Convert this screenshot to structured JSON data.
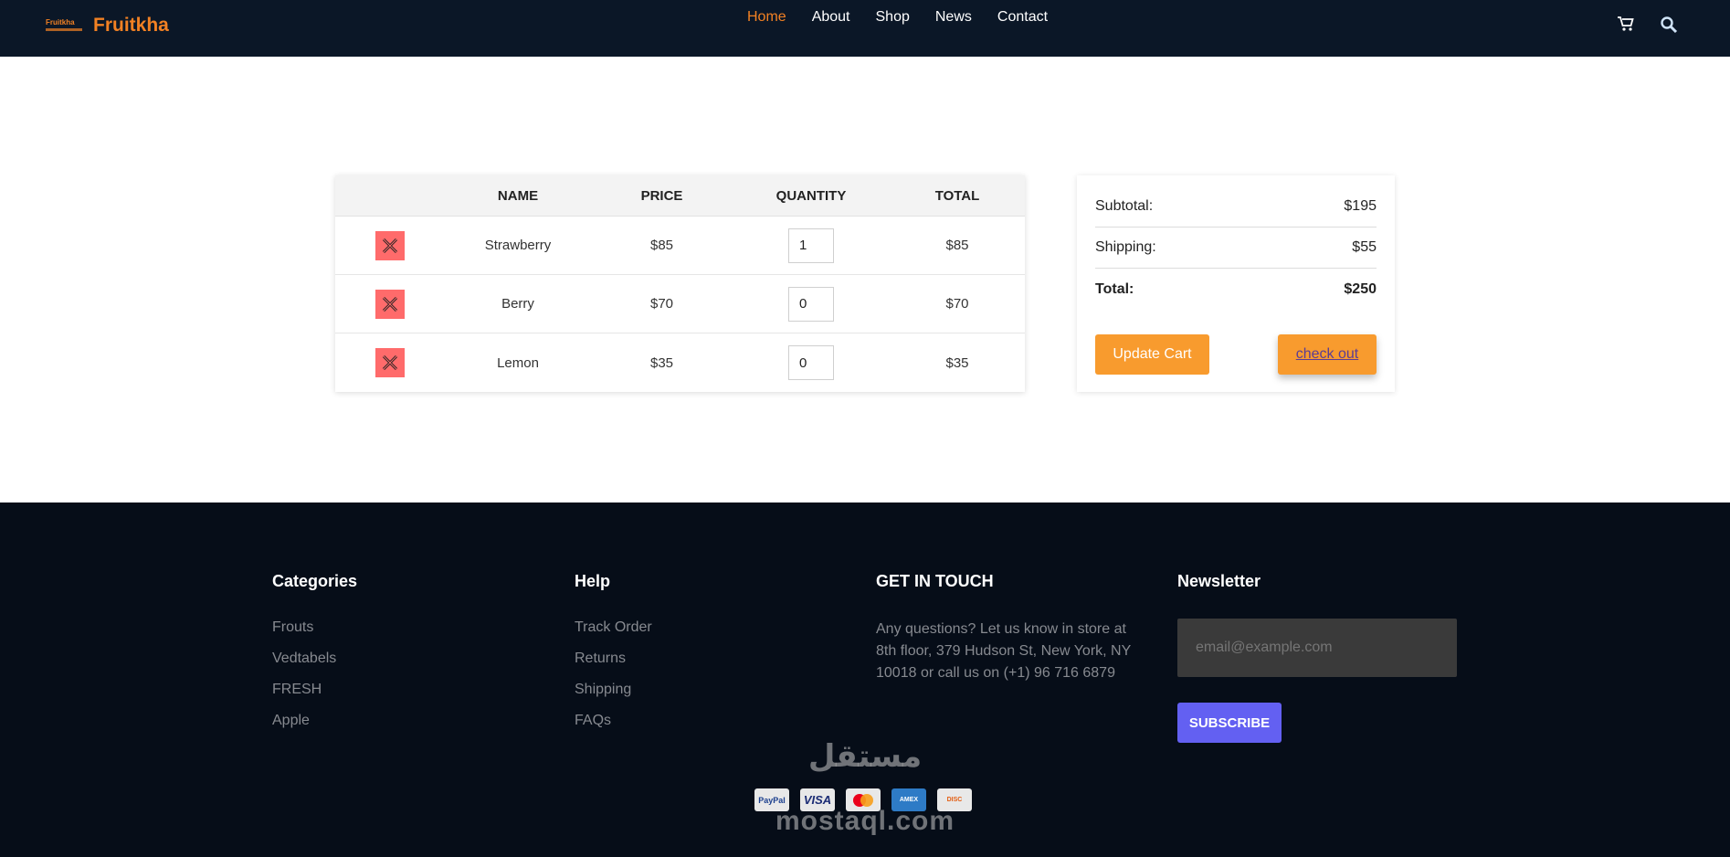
{
  "header": {
    "logo_small": "Fruitkha",
    "logo_text": "Fruitkha",
    "nav": [
      {
        "label": "Home",
        "active": true
      },
      {
        "label": "About",
        "active": false
      },
      {
        "label": "Shop",
        "active": false
      },
      {
        "label": "News",
        "active": false
      },
      {
        "label": "Contact",
        "active": false
      }
    ],
    "cart_icon": "cart-icon",
    "search_icon": "search-icon"
  },
  "cart": {
    "columns": [
      "",
      "NAME",
      "PRICE",
      "QUANTITY",
      "TOTAL"
    ],
    "rows": [
      {
        "name": "Strawberry",
        "price": "$85",
        "quantity": "1",
        "total": "$85"
      },
      {
        "name": "Berry",
        "price": "$70",
        "quantity": "0",
        "total": "$70"
      },
      {
        "name": "Lemon",
        "price": "$35",
        "quantity": "0",
        "total": "$35"
      }
    ]
  },
  "totals": {
    "subtotal_label": "Subtotal:",
    "subtotal_value": "$195",
    "shipping_label": "Shipping:",
    "shipping_value": "$55",
    "total_label": "Total:",
    "total_value": "$250",
    "update_label": "Update Cart",
    "checkout_label": "check out"
  },
  "footer": {
    "categories": {
      "title": "Categories",
      "links": [
        "Frouts",
        "Vedtabels",
        "FRESH",
        "Apple"
      ]
    },
    "help": {
      "title": "Help",
      "links": [
        "Track Order",
        "Returns",
        "Shipping",
        "FAQs"
      ]
    },
    "contact": {
      "title": "GET IN TOUCH",
      "text": "Any questions? Let us know in store at 8th floor, 379 Hudson St, New York, NY 10018 or call us on (+1) 96 716 6879"
    },
    "newsletter": {
      "title": "Newsletter",
      "placeholder": "email@example.com",
      "button": "SUBSCRIBE"
    },
    "payments": [
      "PayPal",
      "VISA",
      "MasterCard",
      "AMERICAN EXPRESS",
      "DISCOVER"
    ],
    "watermark_ar": "مستقل",
    "watermark_en": "mostaql.com"
  },
  "colors": {
    "accent": "#f28123",
    "header_bg": "#0b1727",
    "footer_bg": "#060d18",
    "button_orange": "#f89b2e",
    "remove_red": "#ff6b6b",
    "subscribe": "#6360f2"
  }
}
